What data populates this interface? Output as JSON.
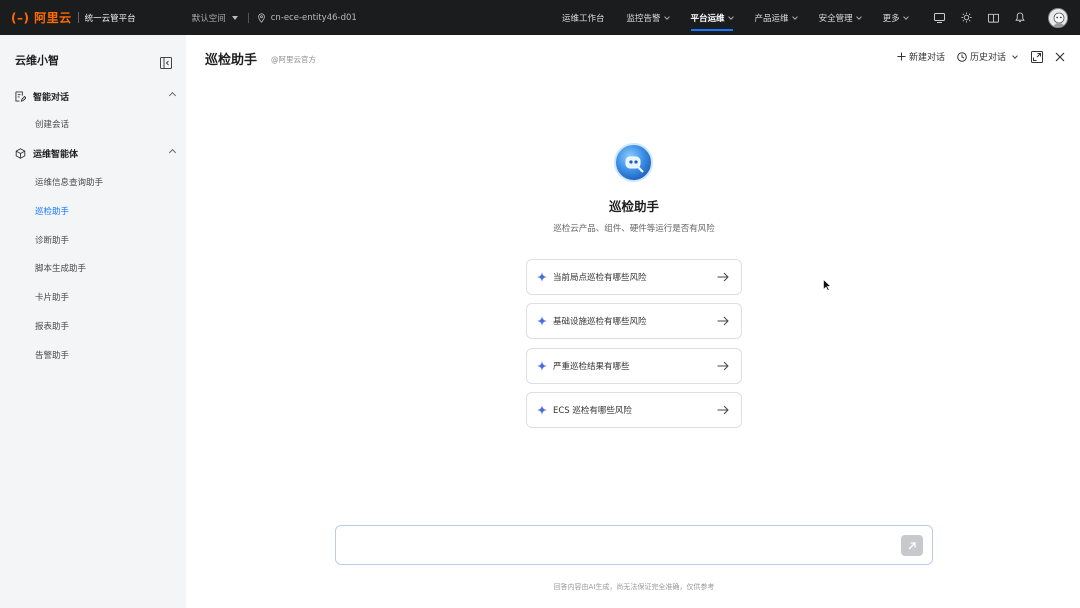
{
  "topbar": {
    "brand": "阿里云",
    "brand_sub": "统一云管平台",
    "space": "默认空间",
    "region": "cn-ece-entity46-d01",
    "nav": [
      {
        "label": "运维工作台",
        "has_menu": false,
        "active": false
      },
      {
        "label": "监控告警",
        "has_menu": true,
        "active": false
      },
      {
        "label": "平台运维",
        "has_menu": true,
        "active": true
      },
      {
        "label": "产品运维",
        "has_menu": true,
        "active": false
      },
      {
        "label": "安全管理",
        "has_menu": true,
        "active": false
      },
      {
        "label": "更多",
        "has_menu": true,
        "active": false
      }
    ],
    "icons": [
      "screen-icon",
      "sun-icon",
      "book-icon",
      "bell-icon"
    ],
    "accent_color": "#1677ff",
    "brand_color": "#ff6a00"
  },
  "sidebar": {
    "title": "云维小智",
    "groups": [
      {
        "label": "智能对话",
        "items": [
          "创建会话"
        ]
      },
      {
        "label": "运维智能体",
        "items": [
          "运维信息查询助手",
          "巡检助手",
          "诊断助手",
          "脚本生成助手",
          "卡片助手",
          "报表助手",
          "告警助手"
        ]
      }
    ],
    "active_item": "巡检助手"
  },
  "header": {
    "title": "巡检助手",
    "subtitle": "@阿里云官方",
    "new_chat": "新建对话",
    "history": "历史对话"
  },
  "assistant": {
    "name": "巡检助手",
    "description": "巡检云产品、组件、硬件等运行是否有风险",
    "suggestions": [
      "当前局点巡检有哪些风险",
      "基础设施巡检有哪些风险",
      "严重巡检结果有哪些",
      "ECS 巡检有哪些风险"
    ]
  },
  "input": {
    "placeholder": "",
    "disclaimer": "回答内容由AI生成，尚无法保证完全准确，仅供参考"
  }
}
